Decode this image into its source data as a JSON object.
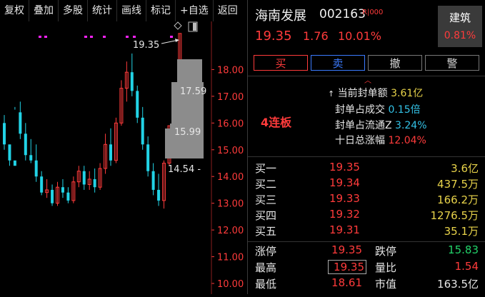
{
  "toolbar": {
    "items": [
      "复权",
      "叠加",
      "多股",
      "统计",
      "画线",
      "标记",
      "+自选",
      "返回"
    ]
  },
  "chart": {
    "y_ticks": [
      "18.00",
      "17.00",
      "16.00",
      "15.00",
      "14.00",
      "13.00",
      "12.00",
      "11.00",
      "10.00"
    ],
    "last_price_label": "19.35",
    "ask_levels": [
      "17.59",
      "15.99",
      "14.54 -"
    ],
    "colors": {
      "up": "#ff3b3b",
      "down": "#22d3e6",
      "marker": "#ff22ff",
      "block": "#8c8c8c"
    }
  },
  "chart_data": {
    "type": "candlestick",
    "ylim": [
      9.6,
      19.8
    ],
    "candles": [
      [
        16.0,
        16.3,
        15.2,
        15.0
      ],
      [
        15.2,
        15.0,
        14.6,
        14.4
      ],
      [
        14.6,
        16.5,
        14.4,
        16.6
      ],
      [
        16.4,
        16.8,
        15.6,
        15.4
      ],
      [
        15.6,
        16.0,
        14.8,
        14.6
      ],
      [
        14.8,
        15.4,
        14.6,
        14.5
      ],
      [
        14.6,
        15.2,
        14.0,
        13.8
      ],
      [
        14.0,
        14.2,
        13.4,
        13.3
      ],
      [
        13.4,
        13.9,
        13.5,
        13.2
      ],
      [
        13.5,
        13.7,
        13.0,
        12.9
      ],
      [
        13.0,
        13.8,
        13.6,
        12.9
      ],
      [
        13.6,
        13.9,
        13.4,
        13.2
      ],
      [
        13.4,
        13.6,
        13.1,
        13.0
      ],
      [
        13.1,
        14.0,
        13.8,
        13.0
      ],
      [
        13.8,
        14.4,
        14.2,
        13.6
      ],
      [
        14.2,
        14.4,
        13.7,
        13.5
      ],
      [
        13.7,
        14.2,
        13.9,
        13.5
      ],
      [
        13.9,
        14.3,
        13.6,
        13.4
      ],
      [
        13.6,
        14.5,
        14.3,
        13.5
      ],
      [
        14.3,
        15.6,
        15.2,
        14.1
      ],
      [
        15.2,
        15.8,
        14.6,
        14.4
      ],
      [
        14.6,
        16.2,
        16.0,
        14.5
      ],
      [
        16.0,
        17.6,
        17.3,
        15.9
      ],
      [
        17.3,
        18.3,
        17.9,
        16.8
      ],
      [
        17.9,
        18.6,
        17.2,
        17.0
      ],
      [
        17.2,
        17.4,
        16.2,
        16.0
      ],
      [
        16.2,
        16.6,
        15.2,
        15.0
      ],
      [
        15.2,
        15.5,
        14.2,
        14.0
      ],
      [
        14.2,
        14.5,
        13.5,
        13.3
      ],
      [
        13.5,
        14.1,
        13.1,
        12.9
      ],
      [
        13.1,
        14.6,
        14.5,
        12.8
      ],
      [
        14.5,
        15.9,
        15.9,
        14.4
      ],
      [
        15.9,
        17.5,
        17.5,
        15.9
      ],
      [
        17.5,
        19.35,
        19.35,
        17.5
      ]
    ],
    "magenta_markers": 5
  },
  "stock": {
    "name": "海南发展",
    "code": "002163",
    "tag": "R|000",
    "price": "19.35",
    "change": "1.76",
    "change_pct": "10.01%"
  },
  "sector": {
    "name": "建筑",
    "pct": "0.81%"
  },
  "trade": {
    "buy": "买",
    "sell": "卖",
    "cancel": "撤",
    "alert": "警"
  },
  "seal": {
    "board": "4连板",
    "rows": [
      {
        "label": "当前封单额",
        "value": "3.61亿",
        "color": "y"
      },
      {
        "label": "封单占成交",
        "value": "0.15倍",
        "color": "c"
      },
      {
        "label": "封单占流通Z",
        "value": "3.24%",
        "color": "c"
      },
      {
        "label": "十日总涨幅",
        "value": "12.04%",
        "color": "r"
      }
    ]
  },
  "orderbook": [
    {
      "level": "买一",
      "price": "19.35",
      "vol": "3.6亿"
    },
    {
      "level": "买二",
      "price": "19.34",
      "vol": "437.5万"
    },
    {
      "level": "买三",
      "price": "19.33",
      "vol": "166.2万"
    },
    {
      "level": "买四",
      "price": "19.32",
      "vol": "1276.5万"
    },
    {
      "level": "买五",
      "price": "19.31",
      "vol": "35.1万"
    }
  ],
  "stats": [
    {
      "l1": "涨停",
      "v1": "19.35",
      "c1": "r",
      "l2": "跌停",
      "v2": "15.83",
      "c2": "g"
    },
    {
      "l1": "最高",
      "v1": "19.35",
      "c1": "r",
      "l2": "量比",
      "v2": "1.54",
      "c2": "r"
    },
    {
      "l1": "最低",
      "v1": "18.61",
      "c1": "r",
      "l2": "市值",
      "v2": "163.5亿",
      "c2": "lbl"
    }
  ]
}
